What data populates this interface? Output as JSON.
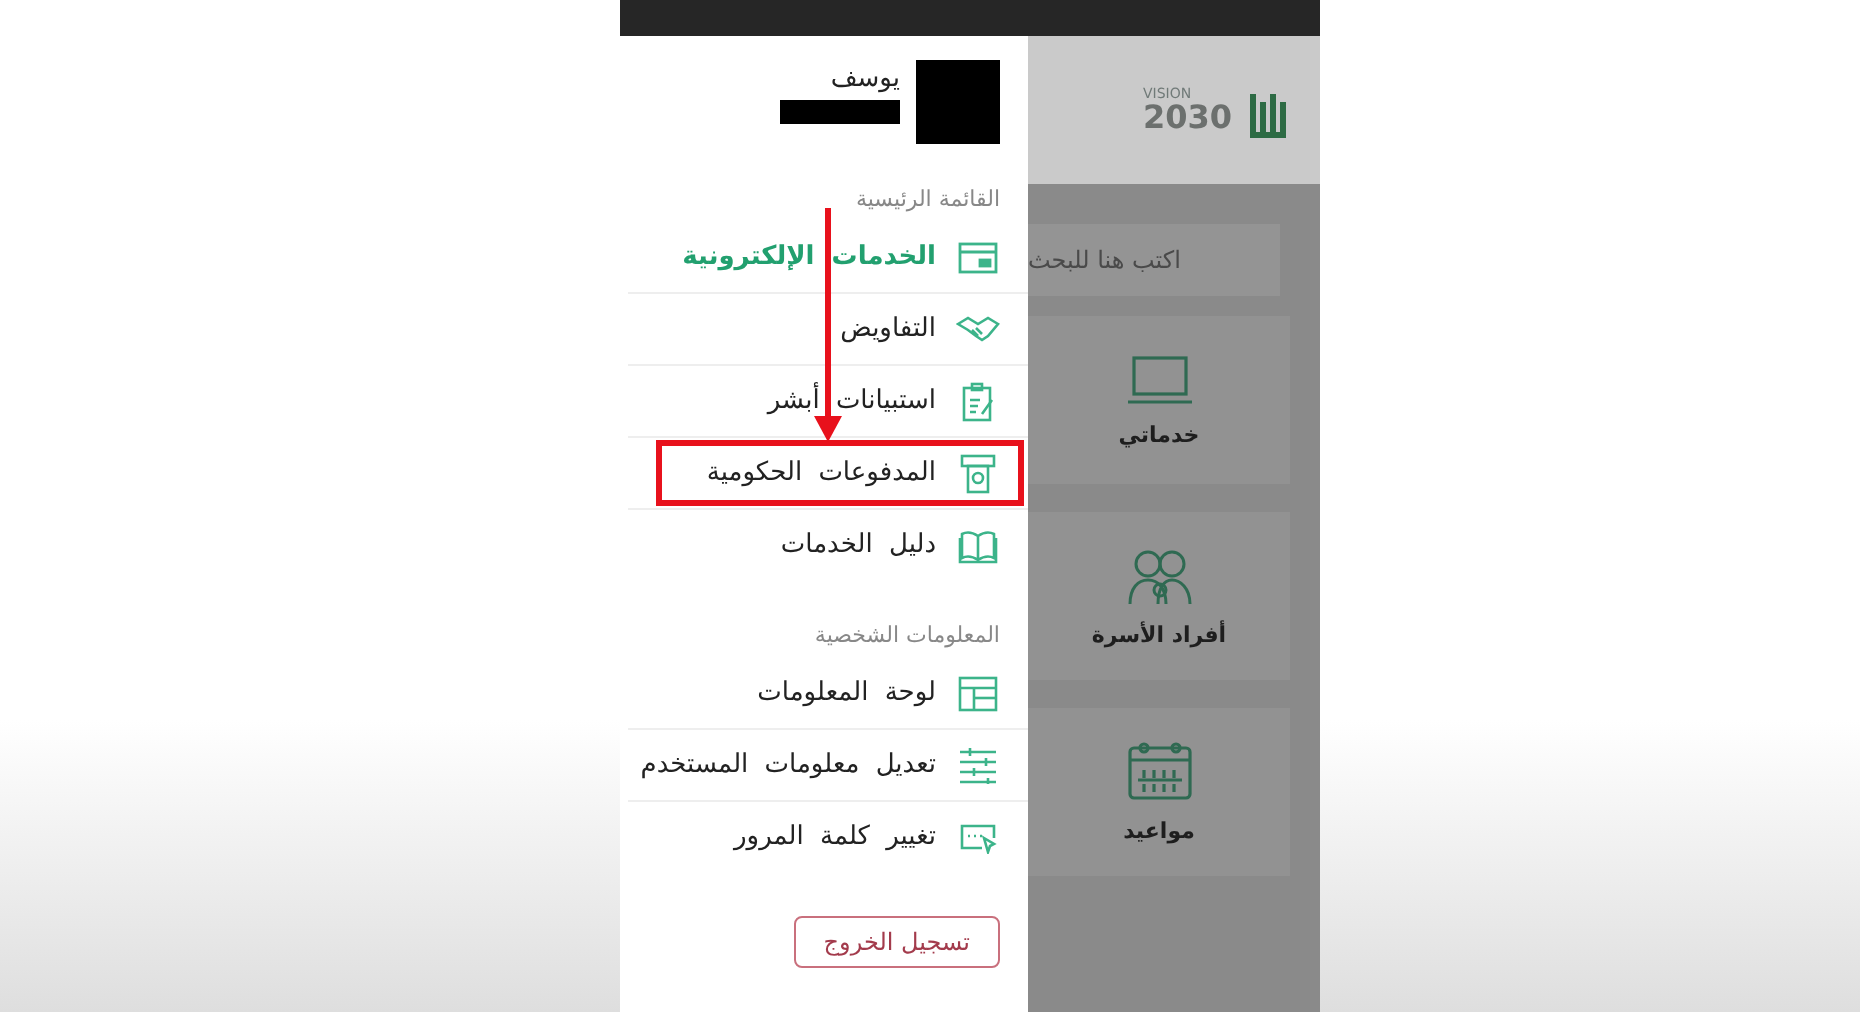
{
  "profile": {
    "name": "يوسف"
  },
  "sections": [
    {
      "title": "القائمة الرئيسية",
      "items": [
        {
          "label": "الخدمات الإلكترونية",
          "selected": true,
          "highlighted": false
        },
        {
          "label": "التفاويض",
          "selected": false,
          "highlighted": false
        },
        {
          "label": "استبيانات أبشر",
          "selected": false,
          "highlighted": false
        },
        {
          "label": "المدفوعات الحكومية",
          "selected": false,
          "highlighted": true
        },
        {
          "label": "دليل الخدمات",
          "selected": false,
          "highlighted": false
        }
      ]
    },
    {
      "title": "المعلومات الشخصية",
      "items": [
        {
          "label": "لوحة المعلومات",
          "selected": false,
          "highlighted": false
        },
        {
          "label": "تعديل معلومات المستخدم",
          "selected": false,
          "highlighted": false
        },
        {
          "label": "تغيير كلمة المرور",
          "selected": false,
          "highlighted": false
        }
      ]
    }
  ],
  "logout_button": "تسجيل الخروج",
  "background_app": {
    "logo": {
      "vision": "VISION",
      "year": "2030"
    },
    "search": {
      "placeholder": "اكتب هنا للبحث"
    },
    "tiles": [
      {
        "label": "خدماتي"
      },
      {
        "label": "أفراد الأسرة"
      },
      {
        "label": "مواعيد"
      }
    ]
  }
}
